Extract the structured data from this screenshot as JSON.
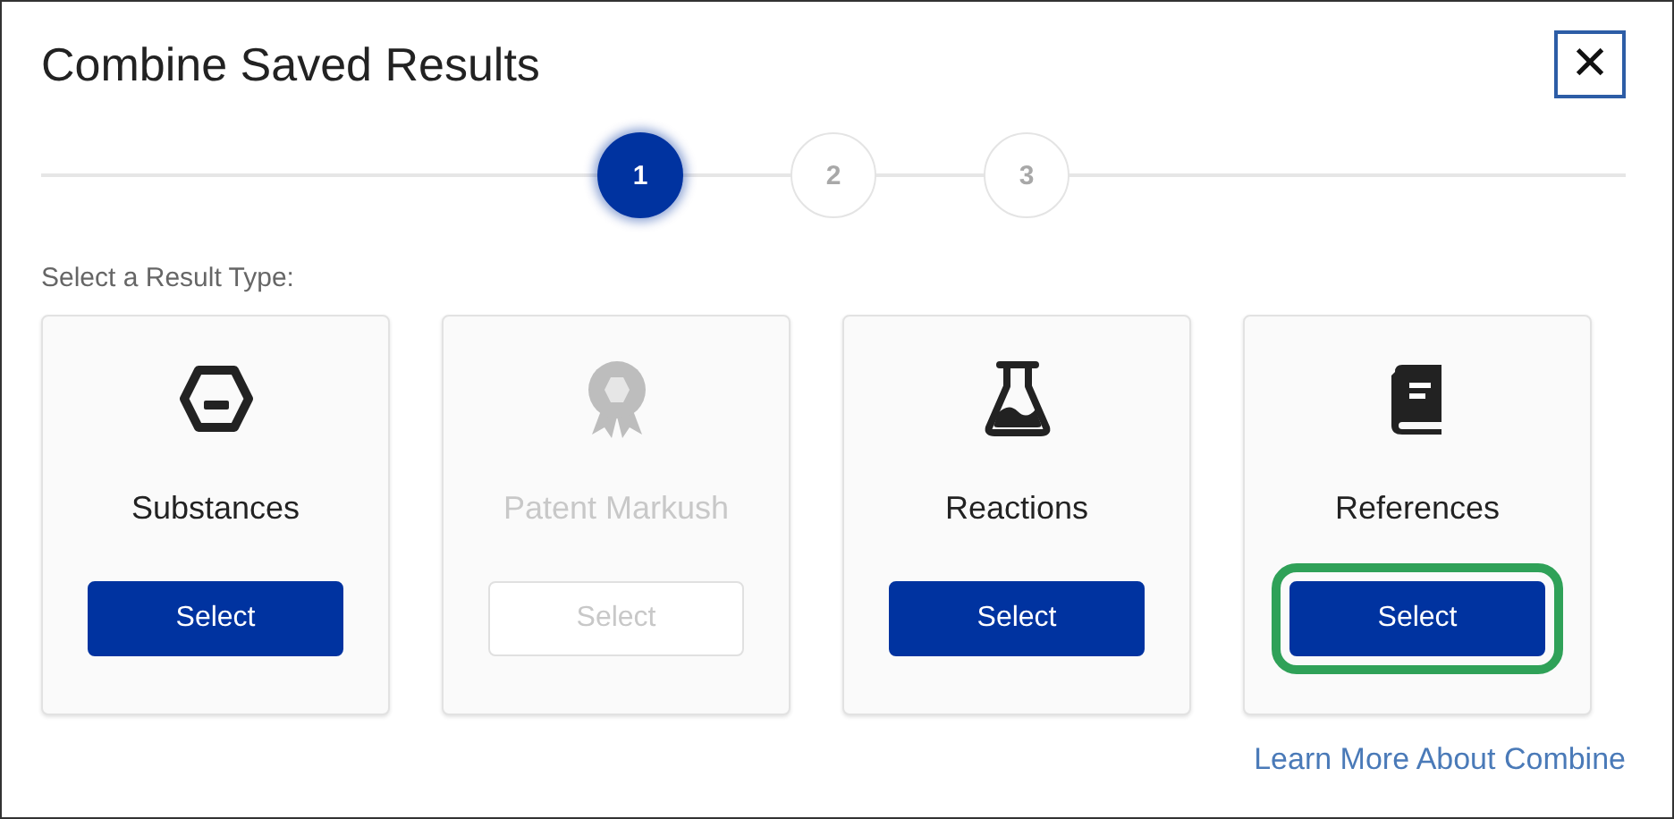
{
  "dialog": {
    "title": "Combine Saved Results",
    "close": "✕"
  },
  "steps": [
    {
      "label": "1",
      "selected": true
    },
    {
      "label": "2",
      "selected": false
    },
    {
      "label": "3",
      "selected": false
    }
  ],
  "prompt": "Select a Result Type:",
  "cards": [
    {
      "kind": "hexagon",
      "label": "Substances",
      "button": "Select",
      "disabled": false,
      "highlighted": false
    },
    {
      "kind": "award",
      "label": "Patent Markush",
      "button": "Select",
      "disabled": true,
      "highlighted": false
    },
    {
      "kind": "flask",
      "label": "Reactions",
      "button": "Select",
      "disabled": false,
      "highlighted": false
    },
    {
      "kind": "book",
      "label": "References",
      "button": "Select",
      "disabled": false,
      "highlighted": true
    }
  ],
  "link": "Learn More About Combine"
}
